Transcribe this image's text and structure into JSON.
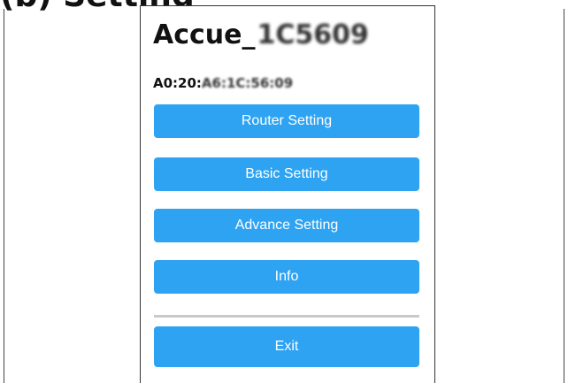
{
  "caption": "(b) Setting",
  "device": {
    "name_prefix": "Accue_",
    "name_masked": "1C5609",
    "mac_prefix": "A0:20:",
    "mac_masked": "A6:1C:56:09"
  },
  "menu": {
    "router_setting": "Router Setting",
    "basic_setting": "Basic Setting",
    "advance_setting": "Advance Setting",
    "info": "Info",
    "exit": "Exit"
  },
  "colors": {
    "button_bg": "#2ea3f2",
    "button_text": "#ffffff",
    "divider": "#c9c9c9"
  }
}
